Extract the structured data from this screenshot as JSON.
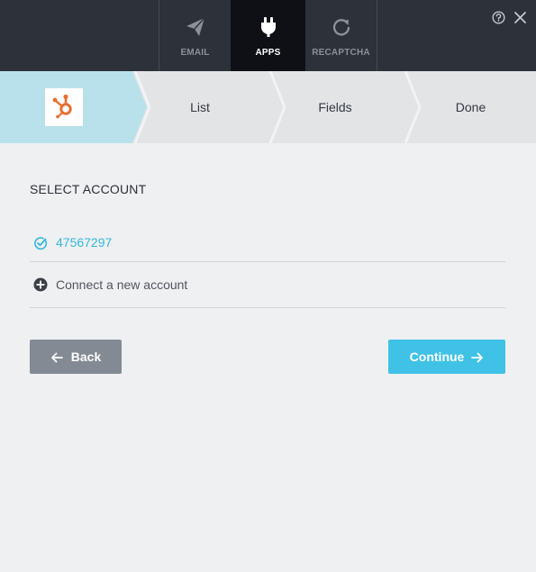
{
  "tabs": [
    {
      "label": "EMAIL",
      "icon": "paper-plane-icon",
      "active": false
    },
    {
      "label": "APPS",
      "icon": "plug-icon",
      "active": true
    },
    {
      "label": "RECAPTCHA",
      "icon": "refresh-icon",
      "active": false
    }
  ],
  "header_icons": [
    "help-icon",
    "close-icon"
  ],
  "steps": [
    {
      "label": "",
      "icon": "hubspot-logo",
      "active": true
    },
    {
      "label": "List",
      "active": false
    },
    {
      "label": "Fields",
      "active": false
    },
    {
      "label": "Done",
      "active": false
    }
  ],
  "section_title": "SELECT ACCOUNT",
  "accounts": [
    {
      "label": "47567297",
      "icon": "check-circle-icon",
      "selected": true
    },
    {
      "label": "Connect a new account",
      "icon": "plus-circle-icon",
      "selected": false
    }
  ],
  "buttons": {
    "back_label": "Back",
    "continue_label": "Continue"
  },
  "colors": {
    "topbar": "#2c313a",
    "active_tab": "#0e1015",
    "active_step": "#b9e1ec",
    "accent": "#3fc2e6",
    "back_button": "#848a94",
    "hubspot_orange": "#e5702f"
  }
}
